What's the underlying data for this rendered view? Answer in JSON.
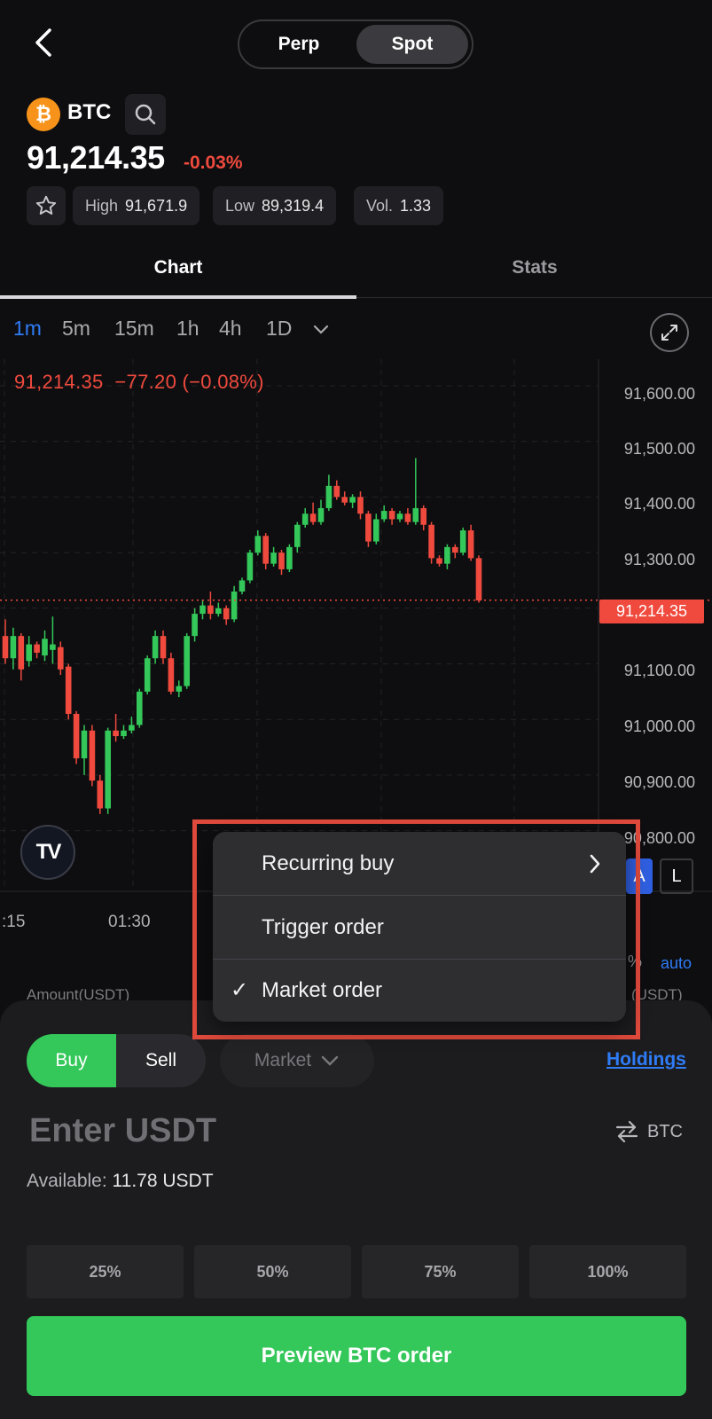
{
  "header": {
    "segments": [
      "Perp",
      "Spot"
    ],
    "selected_segment": "Spot"
  },
  "ticker": {
    "symbol": "BTC",
    "coin_glyph": "₿",
    "price": "91,214.35",
    "change": "-0.03%",
    "stats": [
      {
        "label": "High",
        "value": "91,671.9"
      },
      {
        "label": "Low",
        "value": "89,319.4"
      },
      {
        "label": "Vol.",
        "value": "1.33"
      }
    ]
  },
  "tabs": [
    "Chart",
    "Stats"
  ],
  "intervals": [
    "1m",
    "5m",
    "15m",
    "1h",
    "4h",
    "1D"
  ],
  "active_interval": "1m",
  "chart_data": {
    "type": "candlestick",
    "overlay_price": "91,214.35",
    "overlay_change": "−77.20 (−0.08%)",
    "y_tick_labels": [
      "91,600.00",
      "91,500.00",
      "91,400.00",
      "91,300.00",
      "91,100.00",
      "91,000.00",
      "90,900.00",
      "90,800.00"
    ],
    "y_range": [
      90750,
      91650
    ],
    "current_price_tag": "91,214.35",
    "current_price": 91214.35,
    "x_tick_labels": [
      ":15",
      "01:30"
    ],
    "candles": [
      [
        91150,
        91110,
        91180,
        91100
      ],
      [
        91110,
        91150,
        91165,
        91090
      ],
      [
        91150,
        91090,
        91155,
        91070
      ],
      [
        91105,
        91135,
        91150,
        91095
      ],
      [
        91135,
        91120,
        91140,
        91110
      ],
      [
        91115,
        91145,
        91160,
        91105
      ],
      [
        91125,
        91135,
        91185,
        91100
      ],
      [
        91130,
        91090,
        91140,
        91080
      ],
      [
        91095,
        91010,
        91100,
        91000
      ],
      [
        91010,
        90930,
        91015,
        90920
      ],
      [
        90930,
        90980,
        90990,
        90900
      ],
      [
        90980,
        90890,
        90990,
        90880
      ],
      [
        90890,
        90840,
        90900,
        90830
      ],
      [
        90840,
        90980,
        90985,
        90830
      ],
      [
        90980,
        90970,
        91010,
        90960
      ],
      [
        90970,
        90980,
        90990,
        90965
      ],
      [
        90980,
        90990,
        91005,
        90975
      ],
      [
        90990,
        91050,
        91055,
        90985
      ],
      [
        91050,
        91110,
        91115,
        91045
      ],
      [
        91110,
        91150,
        91160,
        91100
      ],
      [
        91150,
        91110,
        91160,
        91100
      ],
      [
        91110,
        91050,
        91120,
        91045
      ],
      [
        91050,
        91060,
        91070,
        91040
      ],
      [
        91060,
        91150,
        91155,
        91055
      ],
      [
        91150,
        91190,
        91200,
        91140
      ],
      [
        91190,
        91205,
        91215,
        91180
      ],
      [
        91205,
        91190,
        91230,
        91180
      ],
      [
        91190,
        91200,
        91210,
        91185
      ],
      [
        91200,
        91180,
        91205,
        91170
      ],
      [
        91180,
        91230,
        91240,
        91175
      ],
      [
        91230,
        91250,
        91255,
        91225
      ],
      [
        91250,
        91300,
        91305,
        91245
      ],
      [
        91300,
        91330,
        91340,
        91295
      ],
      [
        91330,
        91280,
        91335,
        91270
      ],
      [
        91280,
        91300,
        91310,
        91275
      ],
      [
        91300,
        91270,
        91305,
        91260
      ],
      [
        91270,
        91310,
        91315,
        91265
      ],
      [
        91310,
        91350,
        91355,
        91300
      ],
      [
        91350,
        91370,
        91380,
        91345
      ],
      [
        91370,
        91355,
        91390,
        91350
      ],
      [
        91355,
        91380,
        91395,
        91350
      ],
      [
        91380,
        91420,
        91440,
        91375
      ],
      [
        91420,
        91400,
        91430,
        91395
      ],
      [
        91400,
        91390,
        91410,
        91385
      ],
      [
        91390,
        91400,
        91405,
        91380
      ],
      [
        91400,
        91370,
        91410,
        91360
      ],
      [
        91370,
        91320,
        91375,
        91310
      ],
      [
        91320,
        91360,
        91370,
        91315
      ],
      [
        91360,
        91375,
        91385,
        91355
      ],
      [
        91375,
        91360,
        91380,
        91350
      ],
      [
        91360,
        91370,
        91375,
        91355
      ],
      [
        91370,
        91355,
        91380,
        91350
      ],
      [
        91355,
        91380,
        91470,
        91350
      ],
      [
        91380,
        91350,
        91385,
        91340
      ],
      [
        91350,
        91290,
        91355,
        91280
      ],
      [
        91290,
        91280,
        91295,
        91275
      ],
      [
        91280,
        91310,
        91315,
        91270
      ],
      [
        91310,
        91300,
        91315,
        91290
      ],
      [
        91300,
        91340,
        91345,
        91295
      ],
      [
        91340,
        91290,
        91350,
        91285
      ],
      [
        91290,
        91214,
        91295,
        91210
      ]
    ]
  },
  "chart_controls": {
    "tv_logo": "TV",
    "btn_a": "A",
    "btn_l": "L",
    "auto": "auto",
    "pct": "%"
  },
  "behind_sheet": {
    "amount_label": "Amount(USDT)",
    "right_label": "(USDT)"
  },
  "menu": {
    "items": [
      {
        "label": "Recurring buy",
        "has_submenu": true,
        "checked": false
      },
      {
        "label": "Trigger order",
        "has_submenu": false,
        "checked": false
      },
      {
        "label": "Market order",
        "has_submenu": false,
        "checked": true
      }
    ],
    "check_glyph": "✓"
  },
  "order": {
    "buy_label": "Buy",
    "sell_label": "Sell",
    "type_label": "Market",
    "holdings_label": "Holdings",
    "input_placeholder": "Enter USDT",
    "swap_unit": "BTC",
    "available_label": "Available:",
    "available_value": "11.78 USDT",
    "percent_buttons": [
      "25%",
      "50%",
      "75%",
      "100%"
    ],
    "preview_label": "Preview BTC order"
  },
  "colors": {
    "up": "#34c759",
    "down": "#f04a3e",
    "accent": "#2f7cf6",
    "highlight_border": "#e04a3c"
  }
}
